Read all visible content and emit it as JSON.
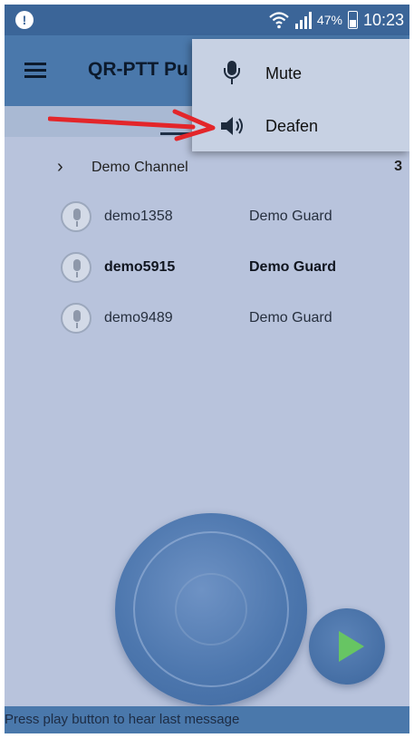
{
  "status_bar": {
    "notification_icon": "alert-icon",
    "battery_percent": "47%",
    "time": "10:23"
  },
  "app_bar": {
    "title": "QR-PTT Pu"
  },
  "channel": {
    "name": "Demo Channel",
    "count": "3"
  },
  "users": [
    {
      "name": "demo1358",
      "role": "Demo Guard",
      "bold": false
    },
    {
      "name": "demo5915",
      "role": "Demo Guard",
      "bold": true
    },
    {
      "name": "demo9489",
      "role": "Demo Guard",
      "bold": false
    }
  ],
  "menu": {
    "items": [
      {
        "label": "Mute",
        "icon": "microphone-icon"
      },
      {
        "label": "Deafen",
        "icon": "speaker-icon"
      }
    ]
  },
  "hint": "Press play button to hear last message",
  "colors": {
    "accent": "#4a78ab",
    "background": "#b8c3dc",
    "play": "#67c563",
    "annotation_arrow": "#e3262a"
  }
}
